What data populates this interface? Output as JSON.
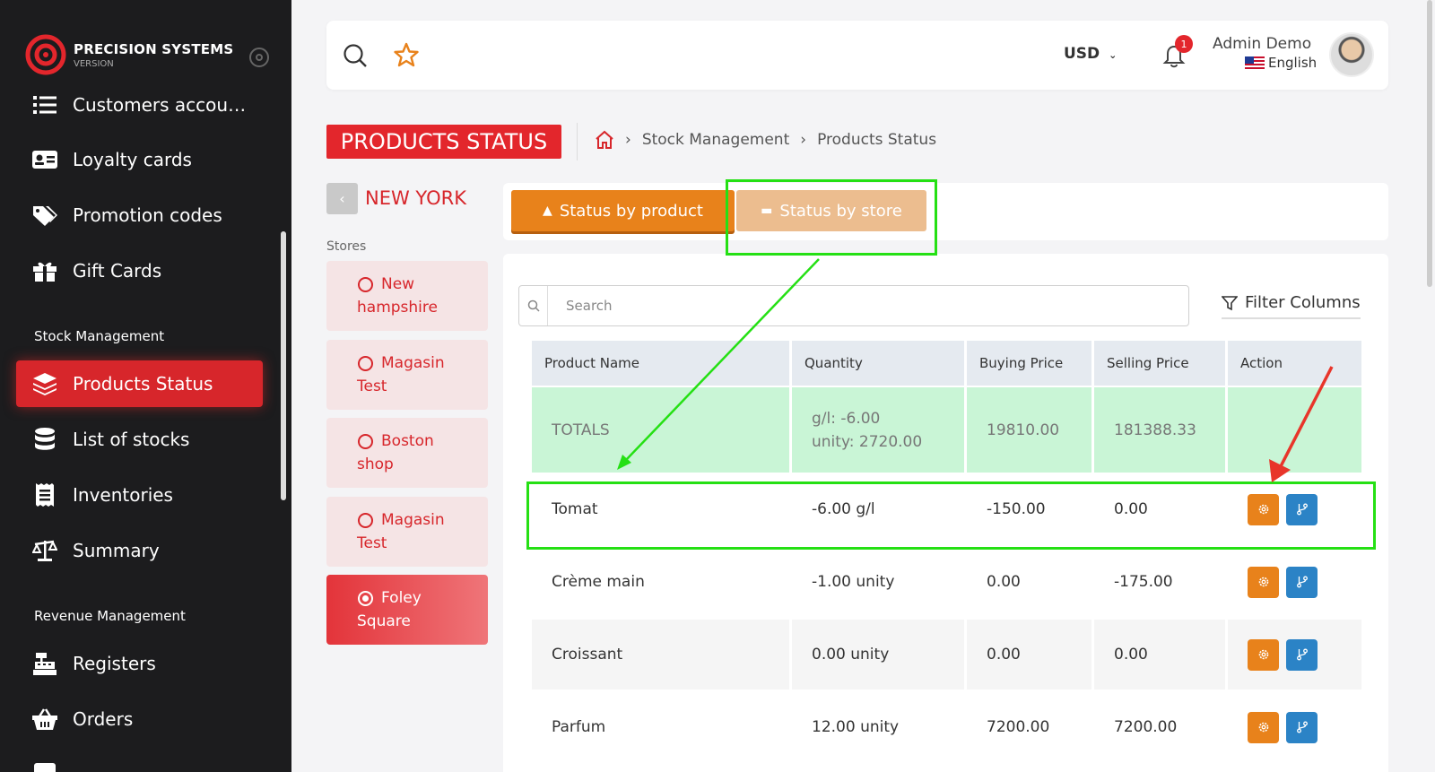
{
  "brand": {
    "name": "PRECISION SYSTEMS",
    "version": "VERSION"
  },
  "sidebar": {
    "items_top": [
      {
        "label": "Customers accou…",
        "icon": "list-icon"
      },
      {
        "label": "Loyalty cards",
        "icon": "id-card-icon"
      },
      {
        "label": "Promotion codes",
        "icon": "tags-icon"
      },
      {
        "label": "Gift Cards",
        "icon": "gift-icon"
      }
    ],
    "section_stock": "Stock Management",
    "items_stock": [
      {
        "label": "Products Status",
        "icon": "layers-icon",
        "active": true
      },
      {
        "label": "List of stocks",
        "icon": "database-icon"
      },
      {
        "label": "Inventories",
        "icon": "receipt-icon"
      },
      {
        "label": "Summary",
        "icon": "balance-scale-icon"
      }
    ],
    "section_revenue": "Revenue Management",
    "items_revenue": [
      {
        "label": "Registers",
        "icon": "cash-register-icon"
      },
      {
        "label": "Orders",
        "icon": "basket-icon"
      }
    ]
  },
  "topbar": {
    "currency": "USD",
    "notification_count": "1",
    "user_name": "Admin Demo",
    "language": "English"
  },
  "header": {
    "title": "PRODUCTS STATUS",
    "breadcrumb": [
      "Stock Management",
      "Products Status"
    ]
  },
  "stores_panel": {
    "city": "NEW YORK",
    "label": "Stores",
    "stores": [
      {
        "line1": "New",
        "line2": "hampshire",
        "active": false
      },
      {
        "line1": "Magasin",
        "line2": "Test",
        "active": false
      },
      {
        "line1": "Boston",
        "line2": "shop",
        "active": false
      },
      {
        "line1": "Magasin",
        "line2": "Test",
        "active": false
      },
      {
        "line1": "Foley",
        "line2": "Square",
        "active": true
      }
    ]
  },
  "tabs": {
    "by_product": "Status by product",
    "by_store": "Status by store"
  },
  "table": {
    "search_placeholder": "Search",
    "filter_label": "Filter Columns",
    "columns": [
      "Product Name",
      "Quantity",
      "Buying Price",
      "Selling Price",
      "Action"
    ],
    "totals": {
      "name": "TOTALS",
      "qty1": "g/l: -6.00",
      "qty2": "unity: 2720.00",
      "buying": "19810.00",
      "selling": "181388.33"
    },
    "rows": [
      {
        "name": "Tomat",
        "qty": "-6.00 g/l",
        "buying": "-150.00",
        "selling": "0.00"
      },
      {
        "name": "Crème main",
        "qty": "-1.00 unity",
        "buying": "0.00",
        "selling": "-175.00"
      },
      {
        "name": "Croissant",
        "qty": "0.00 unity",
        "buying": "0.00",
        "selling": "0.00"
      },
      {
        "name": "Parfum",
        "qty": "12.00 unity",
        "buying": "7200.00",
        "selling": "7200.00"
      }
    ]
  },
  "colors": {
    "brand_red": "#d7262b",
    "orange": "#e8821b",
    "blue": "#2b83c6",
    "totals_green": "#c9f5d6",
    "annotation_green": "#25e014",
    "annotation_red": "#e8352a"
  }
}
